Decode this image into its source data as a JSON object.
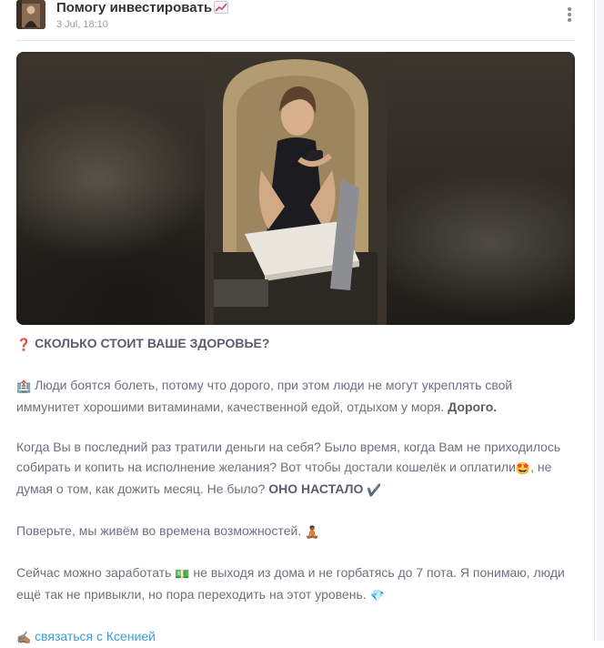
{
  "post": {
    "author": "Помогу инвестировать",
    "author_icon": "chart-increasing-icon",
    "date": "3 Jul, 18:10",
    "menu_icon": "more-vertical-icon"
  },
  "photo": {
    "subject": "woman-with-coffee-cup-photo"
  },
  "body": {
    "title_emoji": "❓",
    "title": "СКОЛЬКО СТОИТ ВАШЕ ЗДОРОВЬЕ?",
    "p1_emoji": "🏥",
    "p1_line1": "Люди боятся болеть, потому что дорого, при этом люди не могут укреплять свой",
    "p1_line2": "иммунитет хорошими витаминами, качественной едой, отдыхом у моря. ",
    "p1_bold": "Дорого.",
    "p2_line1": "Когда Вы в последний раз тратили деньги на себя? Было время, когда Вам не приходилось",
    "p2_line2a": "собирать и копить на исполнение желания? Вот чтобы достали кошелёк и оплатили",
    "p2_emoji1": "🤩",
    "p2_line2b": ", не",
    "p2_line3": "думая о том, как дожить месяц. Не было? ",
    "p2_bold": "ОНО НАСТАЛО",
    "p2_emoji2": "✔️",
    "p3": "Поверьте, мы живём во времена возможностей. ",
    "p3_emoji": "🧘🏾",
    "p4_line1a": "Сейчас можно заработать",
    "p4_emoji1": "💵",
    "p4_line1b": " не выходя из дома и не горбатясь до 7 пота. Я понимаю, люди",
    "p4_line2": "ещё так не привыкли, но пора переходить на этот уровень.",
    "p4_emoji2": "💎",
    "contact_emoji": "✍🏽",
    "contact_link": "связаться с Ксенией"
  },
  "colors": {
    "link": "#3a9ed6",
    "text": "#6f6f7f",
    "author": "#333336",
    "date": "#9a9aa5"
  }
}
